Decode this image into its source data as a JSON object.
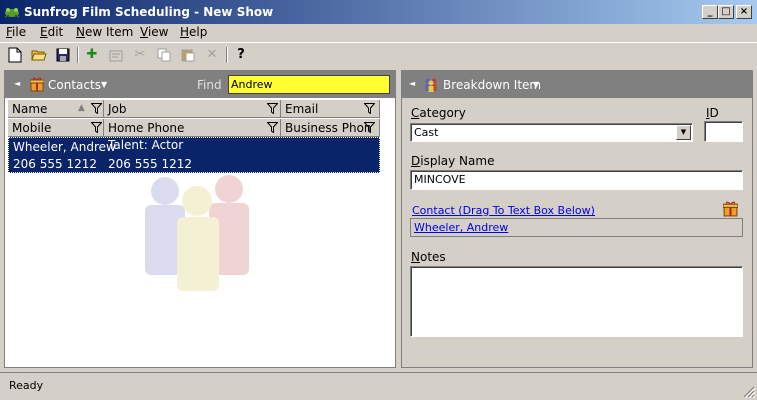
{
  "window": {
    "title": "Sunfrog Film Scheduling - New Show",
    "minimize_glyph": "_",
    "maximize_glyph": "□",
    "close_glyph": "×"
  },
  "menu": {
    "items": [
      {
        "key": "F",
        "rest": "ile"
      },
      {
        "key": "E",
        "rest": "dit"
      },
      {
        "key": "N",
        "rest": "ew Item"
      },
      {
        "key": "V",
        "rest": "iew"
      },
      {
        "key": "H",
        "rest": "elp"
      }
    ]
  },
  "toolbar": {
    "icons": [
      "new-document-icon",
      "open-folder-icon",
      "save-disk-icon",
      "add-plus-icon",
      "properties-icon",
      "cut-scissors-icon",
      "copy-icon",
      "paste-icon",
      "delete-x-icon",
      "help-question-icon"
    ],
    "glyphs": {
      "add": "✚",
      "cut": "✂",
      "delete": "✕",
      "help": "?"
    }
  },
  "left_panel": {
    "header_arrow": "◄",
    "title": "Contacts",
    "dropdown_caret": "▼",
    "find_label": "Find",
    "find_value": "Andrew",
    "grid": {
      "row1_headers": [
        "Name",
        "Job",
        "Email"
      ],
      "row2_headers": [
        "Mobile",
        "Home Phone",
        "Business Phon"
      ],
      "sort_glyph": "▲",
      "rows": [
        {
          "name": "Wheeler, Andrew",
          "job": "Talent: Actor",
          "email": "",
          "mobile": "206 555 1212",
          "home_phone": "206 555 1212",
          "business_phone": ""
        }
      ]
    }
  },
  "right_panel": {
    "header_arrow": "◄",
    "title": "Breakdown Item",
    "dropdown_caret": "▼",
    "category_label_key": "C",
    "category_label_rest": "ategory",
    "category_value": "Cast",
    "combo_glyph": "▼",
    "id_label_key": "I",
    "id_label_rest": "D",
    "id_value": "",
    "display_name_label_key": "D",
    "display_name_label_rest": "isplay Name",
    "display_name_value": "MINCOVE",
    "contact_link": "Contact (Drag To Text Box Below)",
    "contact_value": "Wheeler, Andrew",
    "notes_label_key": "N",
    "notes_label_rest": "otes",
    "notes_value": ""
  },
  "status": {
    "text": "Ready"
  },
  "colors": {
    "titlebar_start": "#0a246a",
    "titlebar_end": "#a6caf0",
    "selection": "#0a246a",
    "find_highlight": "#ffff30",
    "panel_header": "#808080",
    "chrome": "#d4d0c8"
  }
}
